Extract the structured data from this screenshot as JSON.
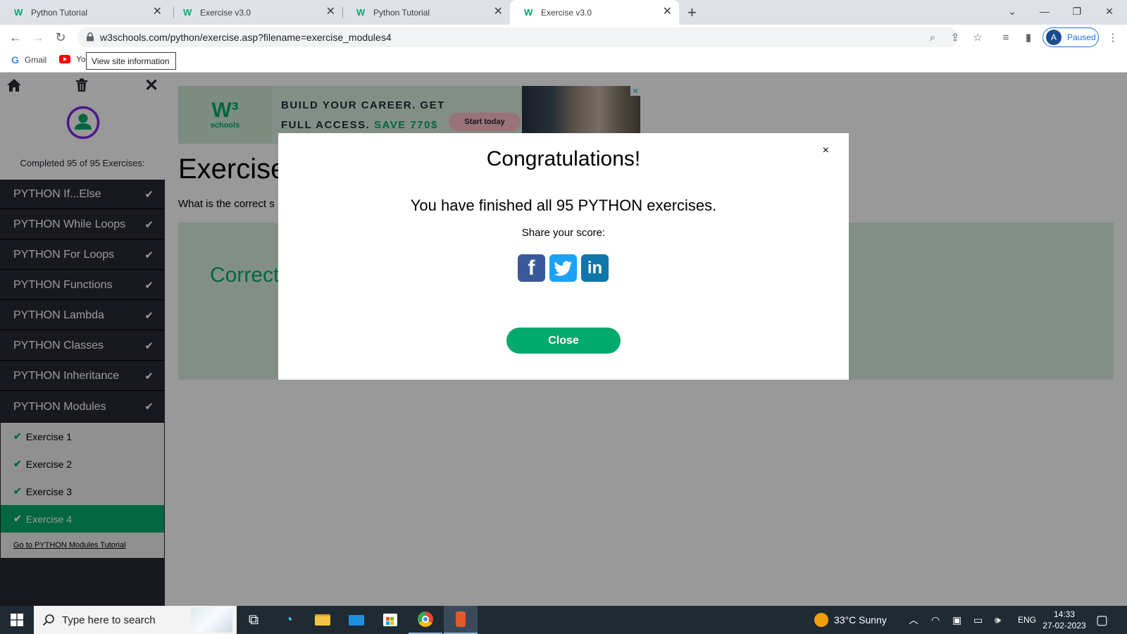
{
  "browser": {
    "tabs": [
      {
        "title": "Python Tutorial",
        "favicon": "w3schools-icon",
        "active": false
      },
      {
        "title": "Exercise v3.0",
        "favicon": "w3schools-icon",
        "active": false
      },
      {
        "title": "Python Tutorial",
        "favicon": "w3schools-icon",
        "active": false
      },
      {
        "title": "Exercise v3.0",
        "favicon": "w3schools-icon",
        "active": true
      }
    ],
    "new_tab_label": "+",
    "url": "w3schools.com/python/exercise.asp?filename=exercise_modules4",
    "profile": {
      "initial": "A",
      "status": "Paused"
    },
    "bookmarks": [
      {
        "label": "Gmail",
        "icon": "google-icon"
      },
      {
        "label": "Yo",
        "icon": "youtube-icon"
      }
    ],
    "tooltip": "View site information"
  },
  "sidebar": {
    "progress": "Completed 95 of 95 Exercises:",
    "sections": [
      {
        "label": "PYTHON If...Else"
      },
      {
        "label": "PYTHON While Loops"
      },
      {
        "label": "PYTHON For Loops"
      },
      {
        "label": "PYTHON Functions"
      },
      {
        "label": "PYTHON Lambda"
      },
      {
        "label": "PYTHON Classes"
      },
      {
        "label": "PYTHON Inheritance"
      },
      {
        "label": "PYTHON Modules"
      }
    ],
    "exercises": [
      {
        "label": "Exercise 1"
      },
      {
        "label": "Exercise 2"
      },
      {
        "label": "Exercise 3"
      },
      {
        "label": "Exercise 4"
      }
    ],
    "goto_link": "Go to PYTHON Modules Tutorial"
  },
  "ad": {
    "logo_text": "schools",
    "line1": "BUILD YOUR CAREER. GET",
    "line2_prefix": "FULL ACCESS.",
    "line2_highlight": "SAVE 770$",
    "cta": "Start today"
  },
  "main": {
    "title": "Exercise:",
    "question": "What is the correct s",
    "result": "Correct!"
  },
  "modal": {
    "title": "Congratulations!",
    "message": "You have finished all 95 PYTHON exercises.",
    "share_label": "Share your score:",
    "social": [
      "facebook-icon",
      "twitter-icon",
      "linkedin-icon"
    ],
    "close_label": "Close",
    "close_x": "×"
  },
  "taskbar": {
    "search_placeholder": "Type here to search",
    "weather": "33°C  Sunny",
    "language": "ENG",
    "time": "14:33",
    "date": "27-02-2023"
  },
  "colors": {
    "accent": "#04aa6d",
    "sidebar_bg": "#282a35",
    "facebook": "#3b5998",
    "twitter": "#1da1f2",
    "linkedin": "#0e76a8"
  }
}
